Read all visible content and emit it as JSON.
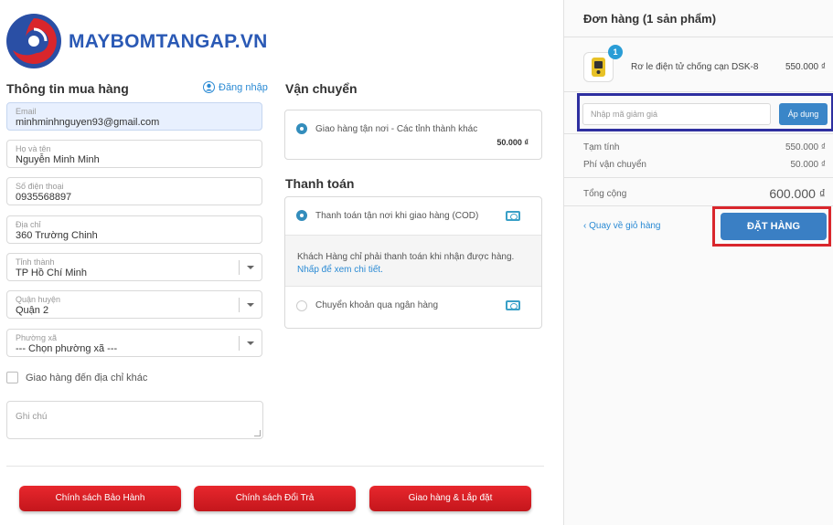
{
  "brand": {
    "name": "MAYBOMTANGAP.VN"
  },
  "buyer": {
    "title": "Thông tin mua hàng",
    "login_label": "Đăng nhập",
    "email": {
      "label": "Email",
      "value": "minhminhnguyen93@gmail.com"
    },
    "name": {
      "label": "Họ và tên",
      "value": "Nguyễn Minh Minh"
    },
    "phone": {
      "label": "Số điện thoại",
      "value": "0935568897"
    },
    "address": {
      "label": "Địa chỉ",
      "value": "360 Trường Chinh"
    },
    "province": {
      "label": "Tỉnh thành",
      "value": "TP Hồ Chí Minh"
    },
    "district": {
      "label": "Quận huyện",
      "value": "Quận 2"
    },
    "ward": {
      "label": "Phường xã",
      "value": "--- Chọn phường xã ---"
    },
    "ship_other_label": "Giao hàng đến địa chỉ khác",
    "note_placeholder": "Ghi chú"
  },
  "shipping": {
    "title": "Vận chuyển",
    "option_label": "Giao hàng tận nơi - Các tỉnh thành khác",
    "option_price": "50.000 ₫"
  },
  "payment": {
    "title": "Thanh toán",
    "cod_label": "Thanh toán tận nơi khi giao hàng (COD)",
    "cod_info": "Khách Hàng chỉ phải thanh toán khi nhận được hàng.",
    "cod_link": "Nhấp để xem chi tiết.",
    "bank_label": "Chuyển khoản qua ngân hàng"
  },
  "order": {
    "title": "Đơn hàng (1 sản phẩm)",
    "item_qty": "1",
    "item_name": "Rơ le điện tử chống cạn DSK-8",
    "item_price": "550.000 ₫",
    "discount_placeholder": "Nhập mã giảm giá",
    "apply_label": "Áp dụng",
    "subtotal_label": "Tạm tính",
    "subtotal_value": "550.000 ₫",
    "shipping_label": "Phí vận chuyển",
    "shipping_value": "50.000 ₫",
    "total_label": "Tổng cộng",
    "total_value": "600.000 ₫",
    "back_label": "Quay về giỏ hàng",
    "place_order_label": "ĐẶT HÀNG"
  },
  "policies": [
    "Chính sách Bảo Hành",
    "Chính sách Đổi Trả",
    "Giao hàng & Lắp đặt"
  ],
  "colors": {
    "brand_blue": "#2a59b5",
    "accent_red": "#d9262c",
    "button_blue": "#3a7fc4",
    "highlight_navy": "#2e2fa0"
  }
}
